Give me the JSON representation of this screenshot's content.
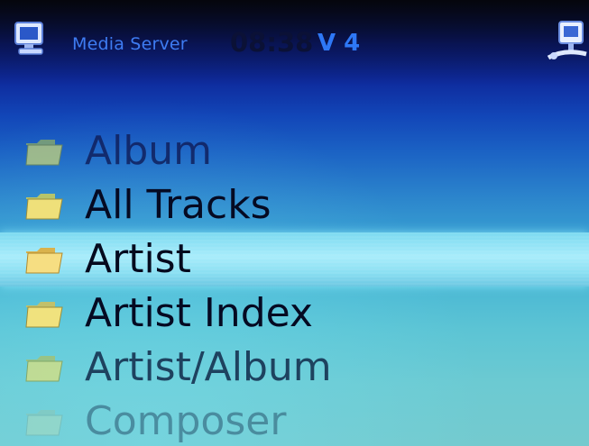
{
  "status": {
    "title": "Media Server",
    "time": "08:38",
    "volume": "V 4",
    "left_icon": "computer-monitor-icon",
    "right_icon": "network-server-icon"
  },
  "menu": {
    "items": [
      {
        "label": "Album",
        "icon": "folder-icon",
        "selected": false
      },
      {
        "label": "All Tracks",
        "icon": "folder-icon",
        "selected": false
      },
      {
        "label": "Artist",
        "icon": "folder-icon",
        "selected": true
      },
      {
        "label": "Artist Index",
        "icon": "folder-icon",
        "selected": false
      },
      {
        "label": "Artist/Album",
        "icon": "folder-icon",
        "selected": false
      },
      {
        "label": "Composer",
        "icon": "folder-icon",
        "selected": false
      }
    ]
  },
  "colors": {
    "highlight": "#a8ecfb",
    "title_blue": "#3e7cf2",
    "volume_blue": "#2e78f6",
    "folder_yellow": "#f3dc7a"
  }
}
